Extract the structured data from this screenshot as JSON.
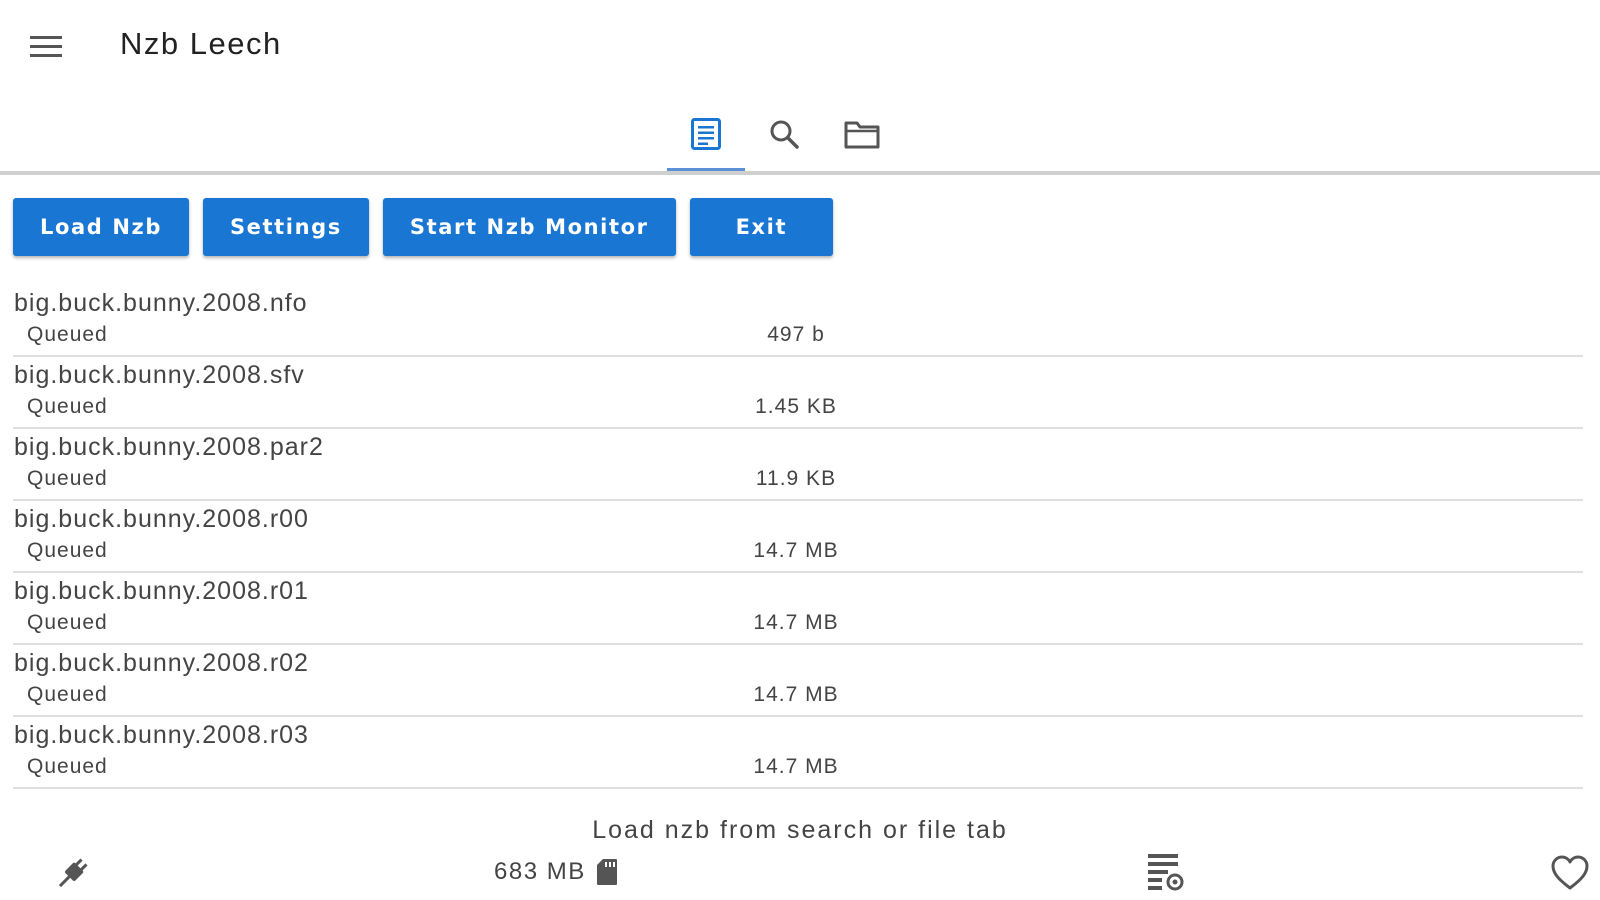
{
  "app": {
    "title": "Nzb Leech"
  },
  "icons": {
    "menu": "menu-icon",
    "tab_queue": "document-list-icon",
    "tab_search": "search-icon",
    "tab_files": "folder-icon",
    "connection": "plug-icon",
    "disk": "sd-card-icon",
    "queue_settings": "queue-settings-icon",
    "favorite": "heart-icon"
  },
  "tabs": {
    "active": "queue"
  },
  "toolbar": {
    "load_label": "Load Nzb",
    "settings_label": "Settings",
    "monitor_label": "Start Nzb Monitor",
    "exit_label": "Exit"
  },
  "files": [
    {
      "name": "big.buck.bunny.2008.nfo",
      "status": "Queued",
      "size": "497 b"
    },
    {
      "name": "big.buck.bunny.2008.sfv",
      "status": "Queued",
      "size": "1.45 KB"
    },
    {
      "name": "big.buck.bunny.2008.par2",
      "status": "Queued",
      "size": "11.9 KB"
    },
    {
      "name": "big.buck.bunny.2008.r00",
      "status": "Queued",
      "size": "14.7 MB"
    },
    {
      "name": "big.buck.bunny.2008.r01",
      "status": "Queued",
      "size": "14.7 MB"
    },
    {
      "name": "big.buck.bunny.2008.r02",
      "status": "Queued",
      "size": "14.7 MB"
    },
    {
      "name": "big.buck.bunny.2008.r03",
      "status": "Queued",
      "size": "14.7 MB"
    }
  ],
  "footer": {
    "hint": "Load nzb from search or file tab",
    "disk_free": "683 MB"
  },
  "colors": {
    "primary": "#1976d2",
    "tab_indicator": "#5b8fd6",
    "icon": "#555555",
    "divider": "#e0e0e0"
  }
}
